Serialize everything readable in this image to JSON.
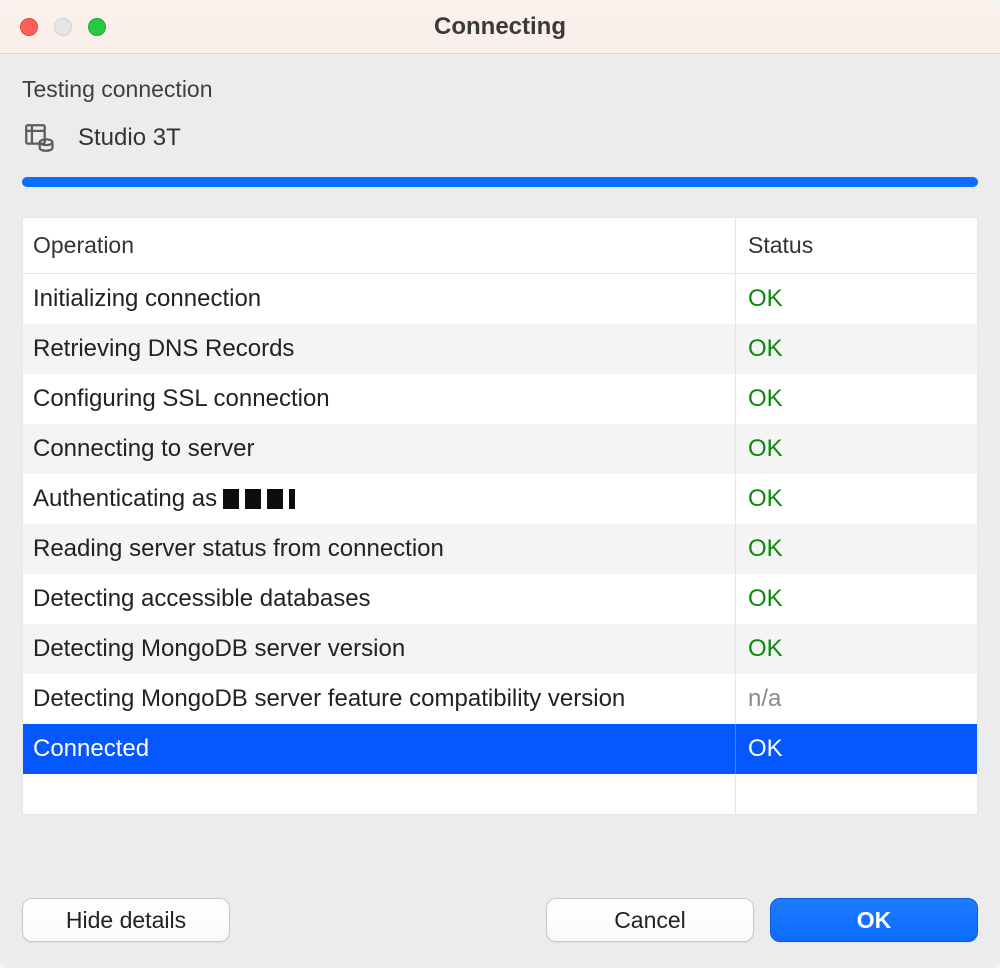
{
  "window": {
    "title": "Connecting"
  },
  "header": {
    "subtitle": "Testing connection",
    "connection_name": "Studio 3T"
  },
  "table": {
    "columns": {
      "operation": "Operation",
      "status": "Status"
    },
    "rows": [
      {
        "operation": "Initializing connection",
        "status": "OK",
        "status_kind": "ok"
      },
      {
        "operation": "Retrieving DNS Records",
        "status": "OK",
        "status_kind": "ok"
      },
      {
        "operation": "Configuring SSL connection",
        "status": "OK",
        "status_kind": "ok"
      },
      {
        "operation": "Connecting to server",
        "status": "OK",
        "status_kind": "ok"
      },
      {
        "operation": "Authenticating as ",
        "redacted_suffix": true,
        "status": "OK",
        "status_kind": "ok"
      },
      {
        "operation": "Reading server status from connection",
        "status": "OK",
        "status_kind": "ok"
      },
      {
        "operation": "Detecting accessible databases",
        "status": "OK",
        "status_kind": "ok"
      },
      {
        "operation": "Detecting MongoDB server version",
        "status": "OK",
        "status_kind": "ok"
      },
      {
        "operation": "Detecting MongoDB server feature compatibility version",
        "status": "n/a",
        "status_kind": "na"
      },
      {
        "operation": "Connected",
        "status": "OK",
        "status_kind": "ok",
        "selected": true
      }
    ]
  },
  "buttons": {
    "hide_details": "Hide details",
    "cancel": "Cancel",
    "ok": "OK"
  }
}
